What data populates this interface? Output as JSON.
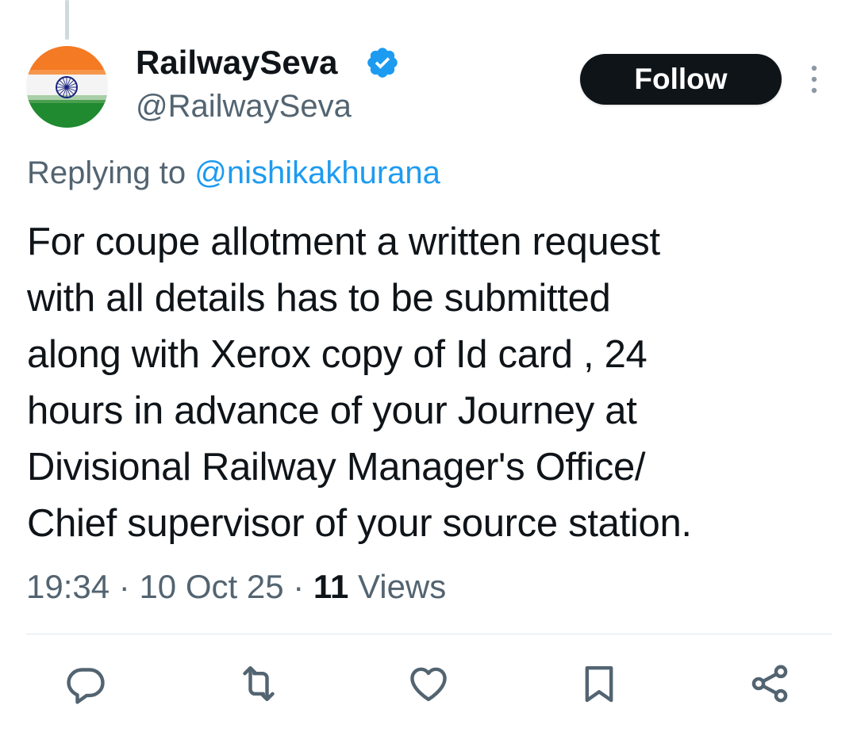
{
  "author": {
    "display_name": "RailwaySeva",
    "handle": "@RailwaySeva",
    "verified_icon": "verified-badge-icon",
    "avatar_icon": "india-flag-avatar"
  },
  "follow_button": {
    "label": "Follow"
  },
  "more_menu": {
    "icon": "more-vertical-icon"
  },
  "reply": {
    "prefix": "Replying to",
    "mention": "@nishikakhurana"
  },
  "tweet": {
    "text_lines": [
      "For coupe allotment a written request",
      "with all details has to be submitted",
      "along with Xerox copy of Id card , 24",
      "hours in advance of your Journey at",
      "Divisional Railway Manager's Office/",
      "Chief supervisor of your source station."
    ]
  },
  "meta": {
    "time": "19:34",
    "separator": "·",
    "date": "10 Oct 25",
    "views_count": "11",
    "views_label": "Views"
  },
  "actions": [
    {
      "name": "reply-icon"
    },
    {
      "name": "retweet-icon"
    },
    {
      "name": "like-icon"
    },
    {
      "name": "bookmark-icon"
    },
    {
      "name": "share-icon"
    }
  ],
  "colors": {
    "text": "#0f1419",
    "secondary": "#536471",
    "link": "#1d9bf0",
    "button_bg": "#0f1419",
    "verified": "#1d9bf0"
  }
}
